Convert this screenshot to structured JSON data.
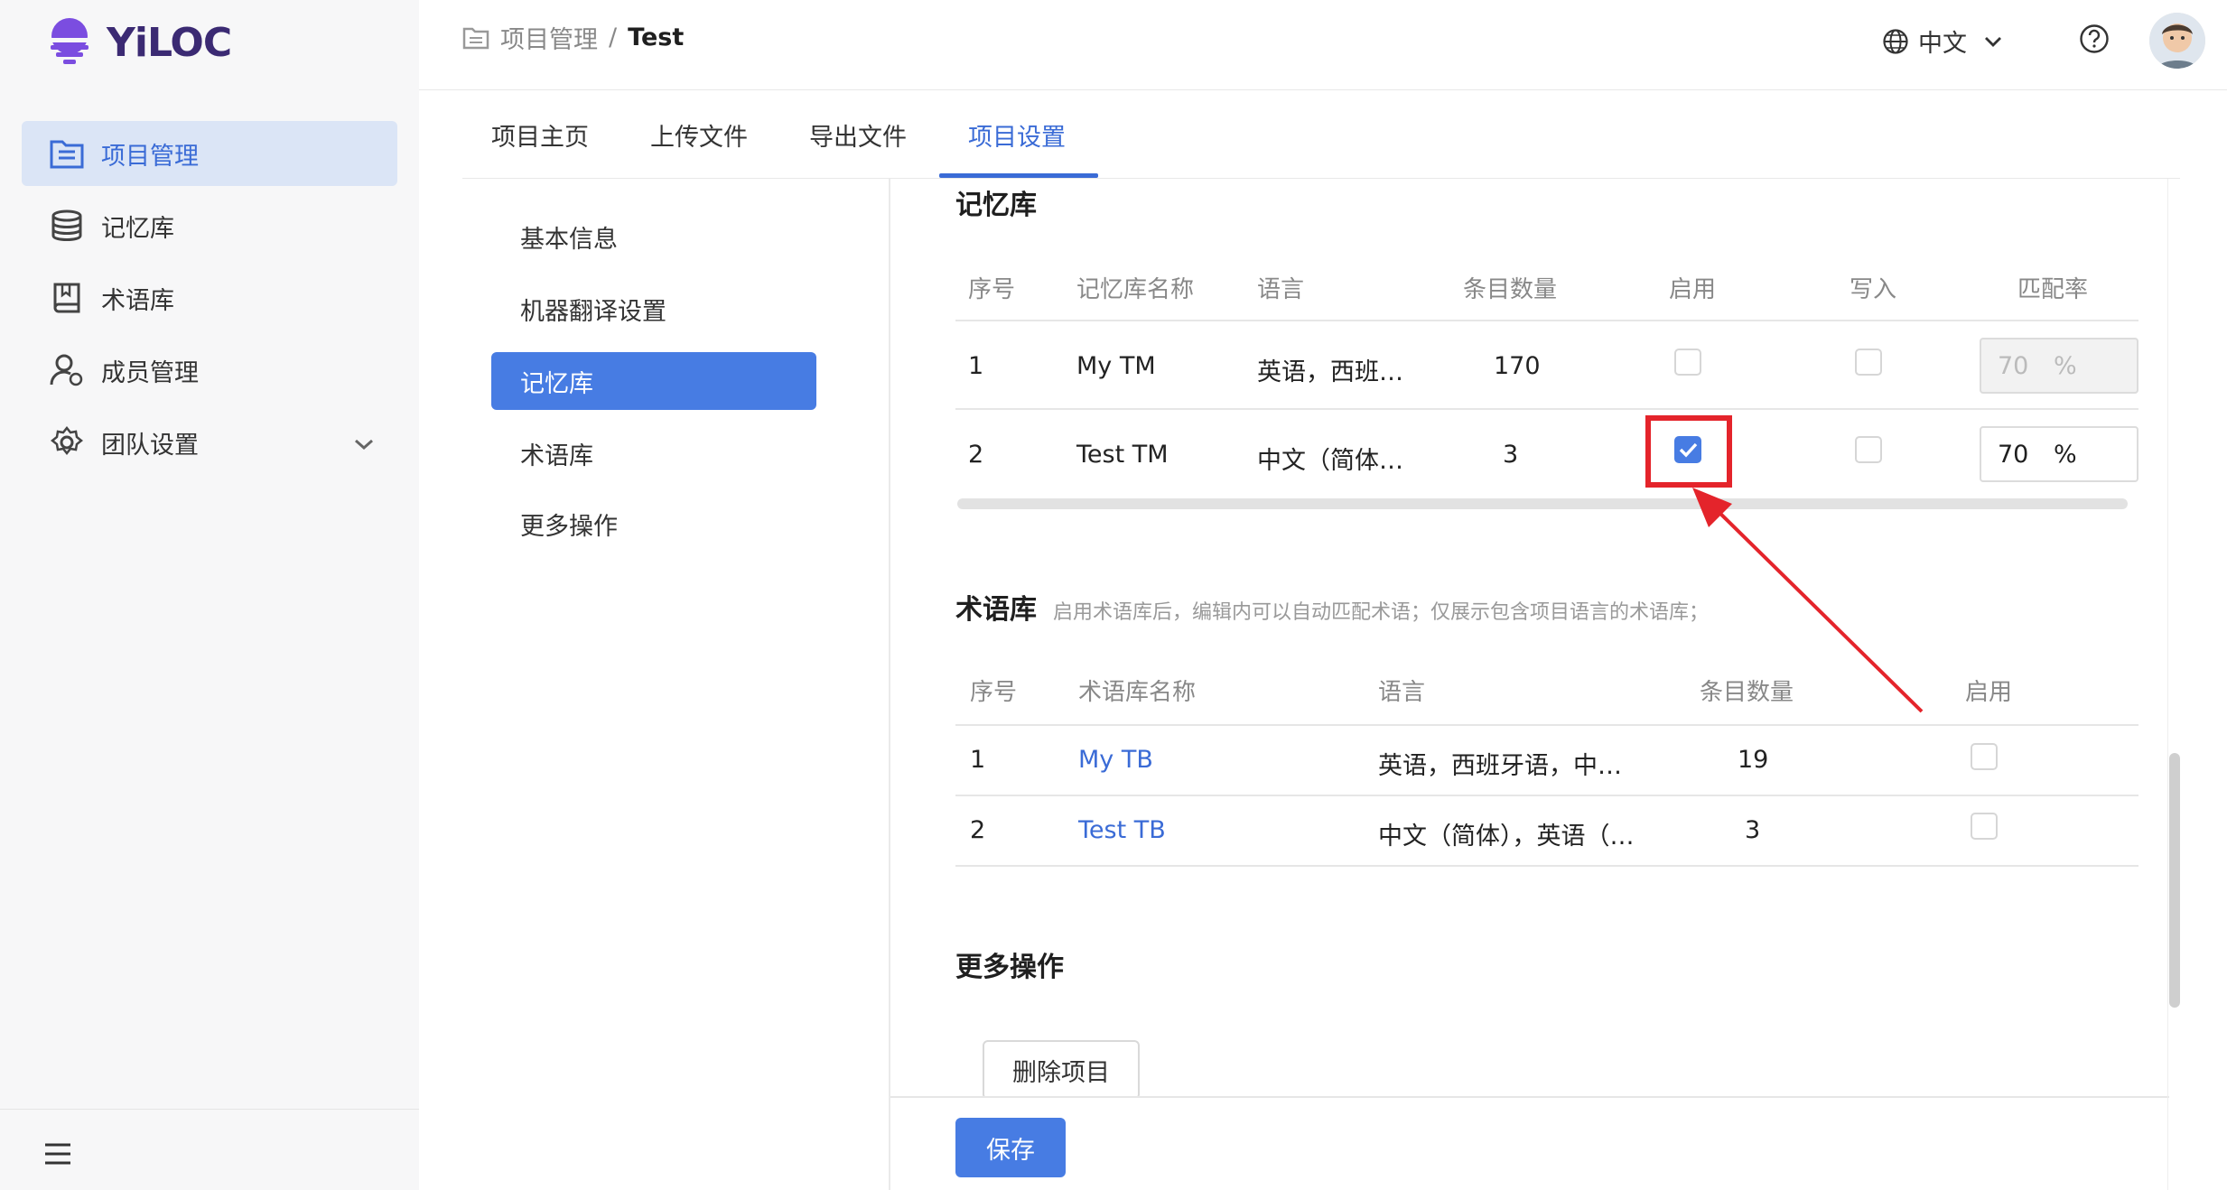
{
  "app": {
    "brand": "YiLOC"
  },
  "sidebar": {
    "items": [
      {
        "label": "项目管理",
        "icon": "project-list-icon",
        "active": true
      },
      {
        "label": "记忆库",
        "icon": "database-icon",
        "active": false
      },
      {
        "label": "术语库",
        "icon": "book-icon",
        "active": false
      },
      {
        "label": "成员管理",
        "icon": "member-icon",
        "active": false
      },
      {
        "label": "团队设置",
        "icon": "gear-icon",
        "active": false
      }
    ]
  },
  "header": {
    "breadcrumb": {
      "parent": "项目管理",
      "separator": "/",
      "current": "Test"
    },
    "language": "中文"
  },
  "tabs": [
    "项目主页",
    "上传文件",
    "导出文件",
    "项目设置"
  ],
  "active_tab": "项目设置",
  "settings_nav": [
    "基本信息",
    "机器翻译设置",
    "记忆库",
    "术语库",
    "更多操作"
  ],
  "active_settings_nav": "记忆库",
  "tm_section": {
    "title": "记忆库",
    "columns": [
      "序号",
      "记忆库名称",
      "语言",
      "条目数量",
      "启用",
      "写入",
      "匹配率"
    ],
    "rows": [
      {
        "index": "1",
        "name": "My TM",
        "language": "英语，西班…",
        "count": "170",
        "enabled": false,
        "write": false,
        "rate": "70",
        "rate_unit": "%",
        "rate_disabled": true
      },
      {
        "index": "2",
        "name": "Test TM",
        "language": "中文（简体…",
        "count": "3",
        "enabled": true,
        "write": false,
        "rate": "70",
        "rate_unit": "%",
        "rate_disabled": false
      }
    ]
  },
  "tb_section": {
    "title": "术语库",
    "hint": "启用术语库后，编辑内可以自动匹配术语；仅展示包含项目语言的术语库；",
    "columns": [
      "序号",
      "术语库名称",
      "语言",
      "条目数量",
      "启用"
    ],
    "rows": [
      {
        "index": "1",
        "name": "My TB",
        "language": "英语，西班牙语，中…",
        "count": "19",
        "enabled": false
      },
      {
        "index": "2",
        "name": "Test TB",
        "language": "中文（简体），英语（…",
        "count": "3",
        "enabled": false
      }
    ]
  },
  "more_section": {
    "title": "更多操作",
    "delete_label": "删除项目"
  },
  "footer": {
    "save_label": "保存"
  },
  "colors": {
    "accent": "#477ce3",
    "annotation": "#e4242b",
    "brand": "#6b3fd6"
  }
}
